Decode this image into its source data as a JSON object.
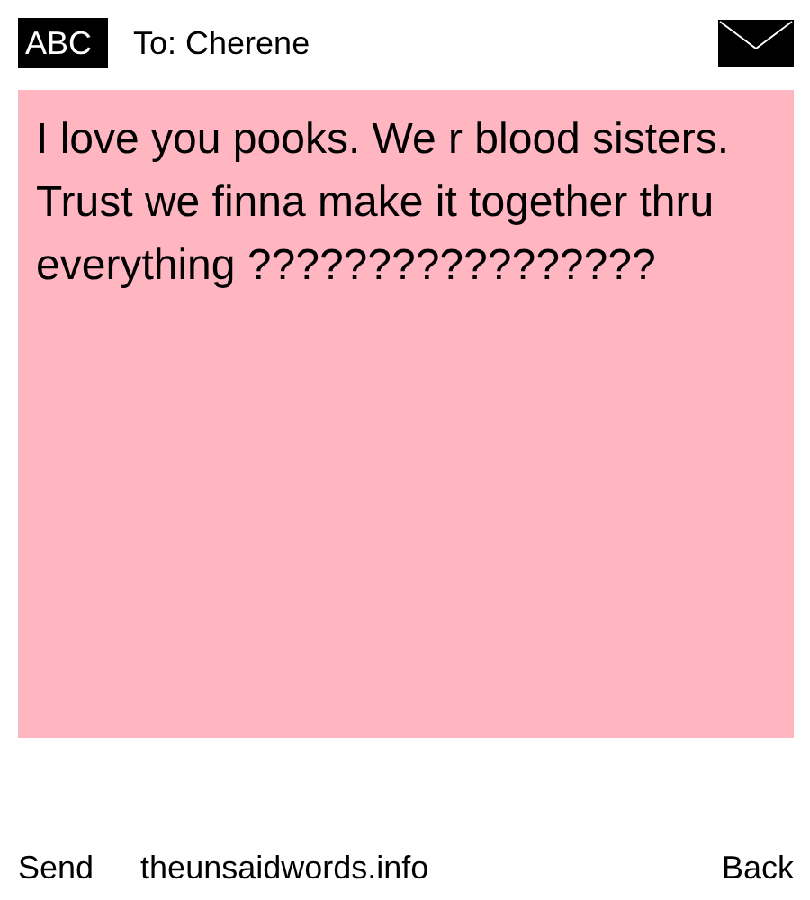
{
  "header": {
    "input_mode": "ABC",
    "recipient": "To: Cherene"
  },
  "message": {
    "text": "I love you pooks. We r blood sisters. Trust we finna make it together thru everything ?????????????????"
  },
  "footer": {
    "left": "Send",
    "center": "theunsaidwords.info",
    "right": "Back"
  }
}
